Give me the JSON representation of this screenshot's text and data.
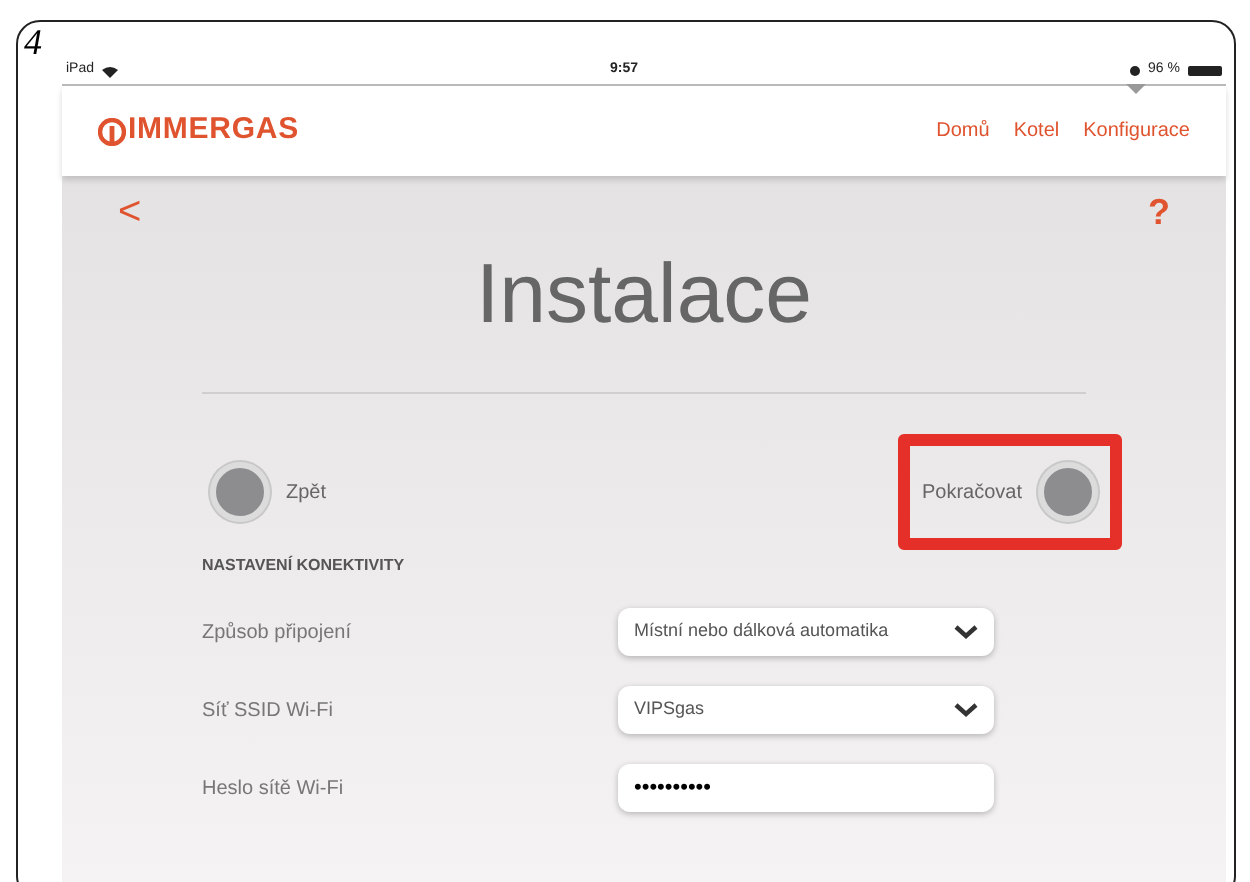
{
  "figure_number": "4",
  "status_bar": {
    "device": "iPad",
    "time": "9:57",
    "battery": "96 %"
  },
  "header": {
    "brand": "IMMERGAS",
    "nav": [
      {
        "label": "Domů",
        "selected": false
      },
      {
        "label": "Kotel",
        "selected": false
      },
      {
        "label": "Konfigurace",
        "selected": true
      }
    ]
  },
  "toolbar": {
    "back": "<",
    "help": "?"
  },
  "title": "Instalace",
  "buttons": [
    {
      "label": "Zpět",
      "kind": "back",
      "highlighted": false
    },
    {
      "label": "Pokračovat",
      "kind": "forward",
      "highlighted": true
    }
  ],
  "section_heading": "NASTAVENÍ KONEKTIVITY",
  "fields": [
    {
      "label": "Způsob připojení",
      "kind": "select",
      "value": "Místní nebo dálková automatika"
    },
    {
      "label": "Síť SSID Wi-Fi",
      "kind": "select",
      "value": "VIPSgas"
    },
    {
      "label": "Heslo sítě Wi-Fi",
      "kind": "password",
      "value": "••••••••••"
    }
  ]
}
